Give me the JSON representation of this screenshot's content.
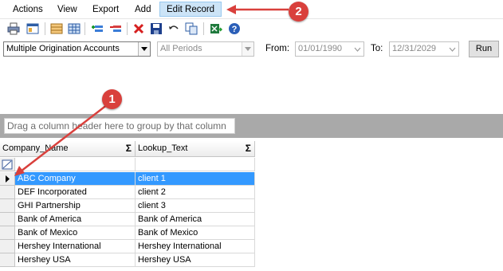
{
  "menu": {
    "items": [
      {
        "label": "Actions"
      },
      {
        "label": "View"
      },
      {
        "label": "Export"
      },
      {
        "label": "Add"
      },
      {
        "label": "Edit Record"
      }
    ]
  },
  "toolbar": {
    "icons": [
      "print-icon",
      "preview-icon",
      "table-icon",
      "grid-icon",
      "add-row-icon",
      "remove-row-icon",
      "delete-icon",
      "save-icon",
      "undo-icon",
      "copy-icon",
      "export-excel-icon",
      "help-icon"
    ]
  },
  "filters": {
    "account_select": "Multiple Origination Accounts",
    "period_select": "All Periods",
    "from_label": "From:",
    "from_date": "01/01/1990",
    "to_label": "To:",
    "to_date": "12/31/2029",
    "run_label": "Run"
  },
  "grid": {
    "group_hint": "Drag a column header here to group by that column",
    "columns": [
      "Company_Name",
      "Lookup_Text"
    ],
    "sigma": "Σ",
    "rows": [
      {
        "company": "ABC Company",
        "lookup": "client 1"
      },
      {
        "company": "DEF Incorporated",
        "lookup": "client 2"
      },
      {
        "company": "GHI Partnership",
        "lookup": "client 3"
      },
      {
        "company": "Bank of America",
        "lookup": "Bank of America"
      },
      {
        "company": "Bank of Mexico",
        "lookup": "Bank of Mexico"
      },
      {
        "company": "Hershey International",
        "lookup": "Hershey International"
      },
      {
        "company": "Hershey USA",
        "lookup": "Hershey USA"
      }
    ]
  },
  "callouts": {
    "one": "1",
    "two": "2"
  },
  "colors": {
    "selected_row": "#3399ff",
    "callout": "#d9403c",
    "active_menu": "#cce4f7"
  }
}
